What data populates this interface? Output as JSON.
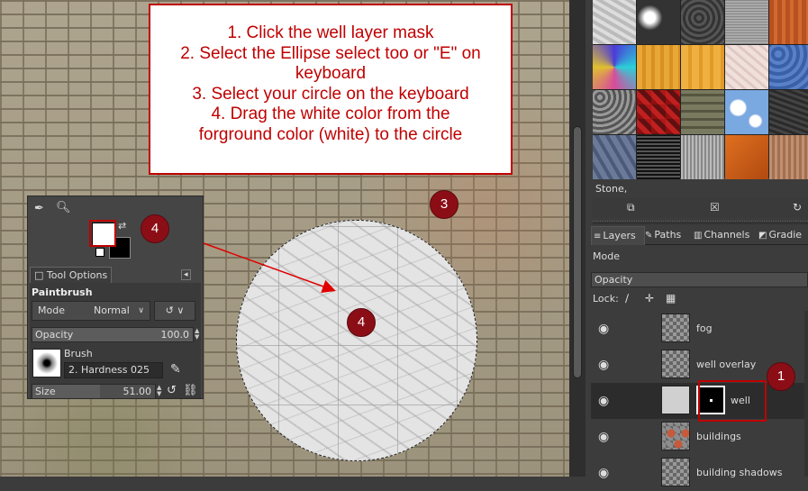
{
  "instructions": {
    "lines": [
      "1. Click the well layer mask",
      "2. Select the Ellipse select too or \"E\" on",
      "keyboard",
      "3. Select your circle on the keyboard",
      "4. Drag the white color from the",
      "forground color (white) to the circle"
    ]
  },
  "badges": {
    "toolbox_fg": "4",
    "selection": "3",
    "circle": "4",
    "layer_mask": "1"
  },
  "toolbox": {
    "tab_label": "Tool Options",
    "tool_name": "Paintbrush",
    "mode_label": "Mode",
    "mode_value": "Normal",
    "opacity_label": "Opacity",
    "opacity_value": "100.0",
    "brush_label": "Brush",
    "brush_name": "2. Hardness 025",
    "size_label": "Size",
    "size_value": "51.00",
    "opacity_fraction": 1.0,
    "size_fraction": 0.55,
    "foreground_color": "#ffffff",
    "background_color": "#000000"
  },
  "patterns": {
    "selected_name": "Stone,"
  },
  "layers_panel": {
    "tabs": [
      "Layers",
      "Paths",
      "Channels",
      "Gradie"
    ],
    "mode_label": "Mode",
    "opacity_label": "Opacity",
    "lock_label": "Lock:",
    "layers": [
      {
        "name": "fog",
        "visible": true
      },
      {
        "name": "well overlay",
        "visible": true
      },
      {
        "name": "well",
        "visible": true,
        "has_mask": true,
        "selected": true
      },
      {
        "name": "buildings",
        "visible": true
      },
      {
        "name": "building shadows",
        "visible": true
      }
    ]
  },
  "colors": {
    "annotation_red": "#c00000",
    "badge": "#8b0e16",
    "panel_bg": "#3c3c3c"
  }
}
